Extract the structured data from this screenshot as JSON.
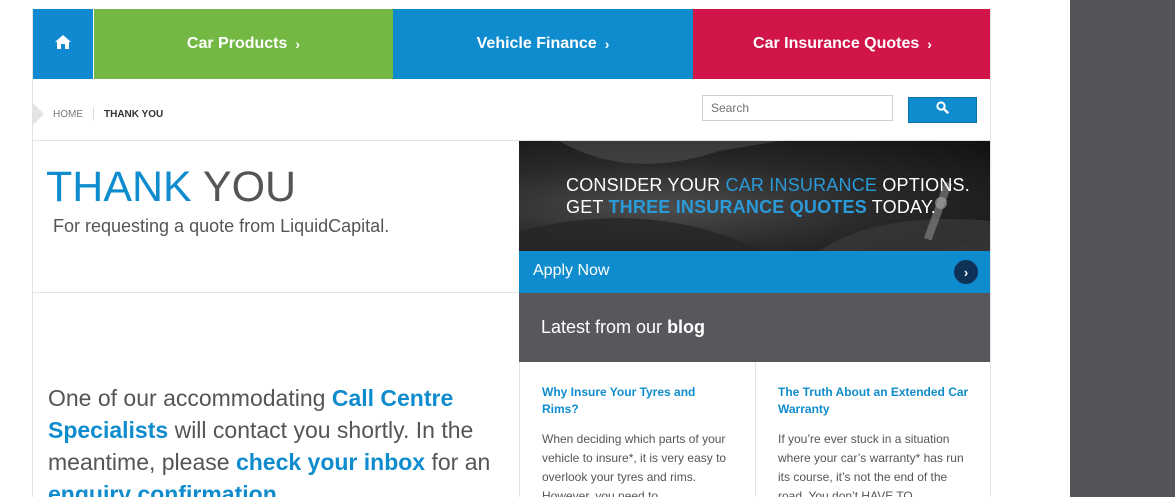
{
  "nav": {
    "home_icon": "home-icon",
    "items": [
      {
        "label": "Car Products"
      },
      {
        "label": "Vehicle Finance"
      },
      {
        "label": "Car Insurance Quotes"
      }
    ],
    "colors": {
      "home": "#1089d0",
      "car": "#72b843",
      "finance": "#0f8ccd",
      "insurance": "#d21549"
    }
  },
  "breadcrumb": {
    "home": "HOME",
    "current": "THANK YOU"
  },
  "search": {
    "placeholder": "Search",
    "button_icon": "search-icon"
  },
  "thankyou": {
    "title_a": "THANK",
    "title_b": "YOU",
    "subtitle": "For requesting a quote from LiquidCapital."
  },
  "banner": {
    "line1_a": "CONSIDER YOUR ",
    "line1_hl": "CAR INSURANCE",
    "line1_b": " OPTIONS.",
    "line2_a": "GET ",
    "line2_hl": "THREE INSURANCE QUOTES",
    "line2_b": " TODAY.",
    "apply_label": "Apply Now"
  },
  "contact": {
    "t1": "One of our accommodating ",
    "h1": "Call Centre Specialists",
    "t2": " will contact you shortly. In the meantime, please ",
    "h2": "check your inbox",
    "t3": " for an ",
    "h3": "enquiry confirmation"
  },
  "blog": {
    "heading_a": "Latest from our ",
    "heading_b": "blog",
    "posts": [
      {
        "title": "Why Insure Your Tyres and Rims?",
        "excerpt": "When deciding which parts of your vehicle to insure*, it is very easy to overlook your tyres and rims. However, you need to"
      },
      {
        "title": "The Truth About an Extended Car Warranty",
        "excerpt": "If you’re ever stuck in a situation where your car’s warranty* has run its course, it’s not the end of the road. You don’t HAVE TO"
      }
    ]
  }
}
